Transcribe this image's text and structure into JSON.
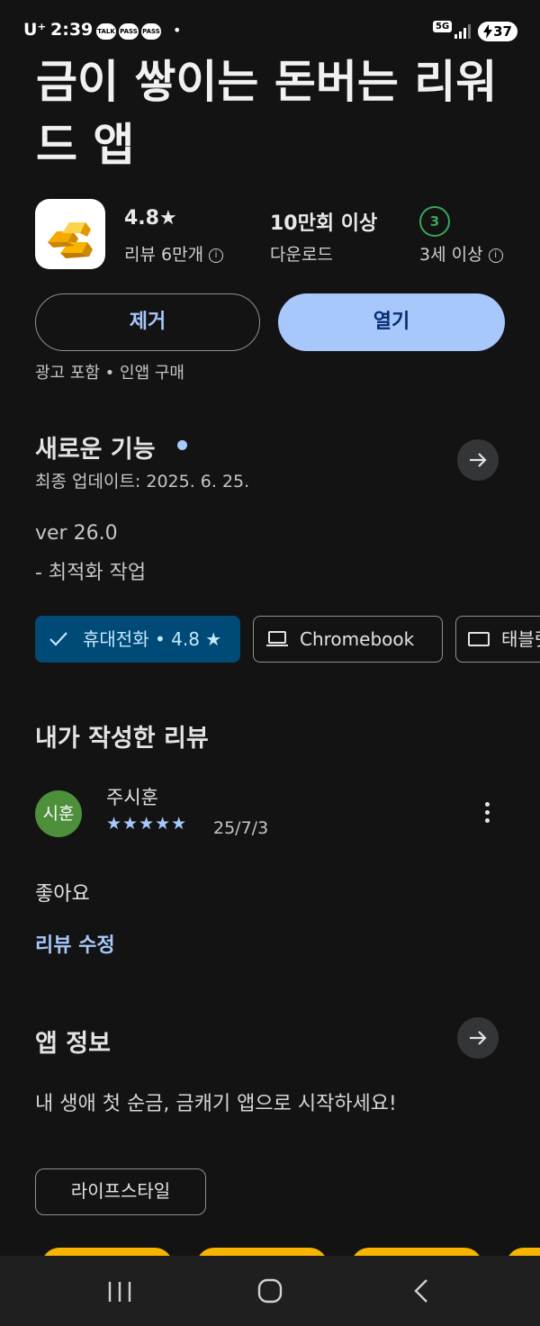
{
  "status_bar": {
    "carrier": "U⁺",
    "time": "2:39",
    "notification_icons": [
      "TALK",
      "PASS",
      "PASS"
    ],
    "network": "5G",
    "battery": "37"
  },
  "app": {
    "title": "금이 쌓이는 돈버는 리워드 앱",
    "rating": "4.8★",
    "reviews_label": "리뷰 6만개",
    "downloads": "10만회 이상",
    "downloads_label": "다운로드",
    "age_rating_number": "3",
    "age_rating_label": "3세 이상",
    "icon": "gold-bars-icon"
  },
  "actions": {
    "uninstall": "제거",
    "open": "열기",
    "ads_note": "광고 포함 • 인앱 구매"
  },
  "whats_new": {
    "title": "새로운 기능",
    "last_updated": "최종 업데이트: 2025. 6. 25.",
    "version": "ver 26.0",
    "notes": "- 최적화 작업"
  },
  "device_chips": [
    {
      "label": "휴대전화 • 4.8 ★",
      "selected": true,
      "icon": "check-icon"
    },
    {
      "label": "Chromebook",
      "selected": false,
      "icon": "laptop-icon"
    },
    {
      "label": "태블릿",
      "selected": false,
      "icon": "tablet-icon"
    }
  ],
  "my_review": {
    "section_title": "내가 작성한 리뷰",
    "avatar_text": "시훈",
    "author": "주시훈",
    "stars": 5,
    "stars_text": "★★★★★",
    "date": "25/7/3",
    "text": "좋아요",
    "edit_label": "리뷰 수정"
  },
  "about": {
    "title": "앱 정보",
    "description": "내 생애 첫 순금, 금캐기 앱으로 시작하세요!",
    "category": "라이프스타일"
  },
  "colors": {
    "background": "#131314",
    "accent": "#a8c7fa",
    "selected_chip": "#004a77",
    "age_green": "#3aa657",
    "avatar_green": "#4d8f3b"
  }
}
